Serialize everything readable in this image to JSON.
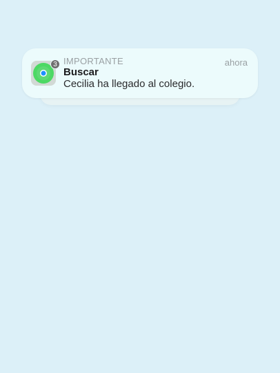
{
  "notification": {
    "category": "IMPORTANTE",
    "app_name": "Buscar",
    "message": "Cecilia ha llegado al colegio.",
    "time": "ahora",
    "badge_count": "3",
    "icon": "find-my-icon"
  },
  "colors": {
    "background": "#dcf0f8",
    "card": "#ecfbfc",
    "icon_green": "#4cd964",
    "icon_dot": "#1e90ff"
  }
}
